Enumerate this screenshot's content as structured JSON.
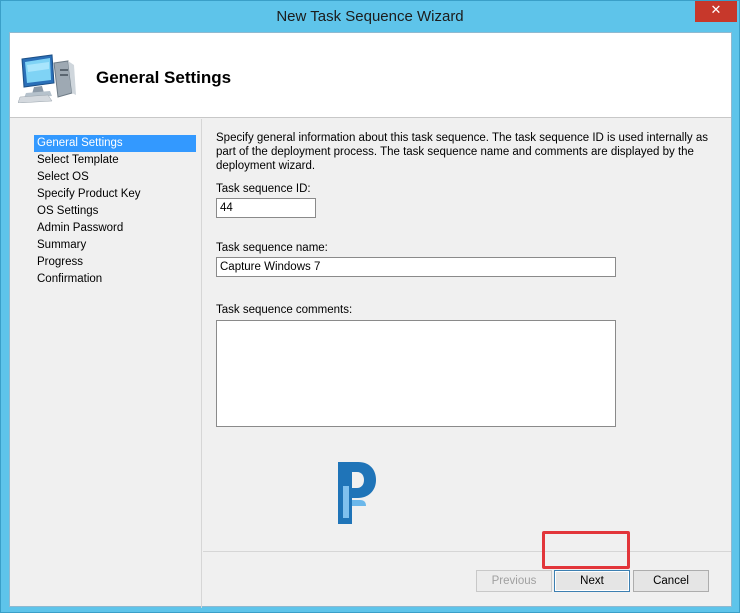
{
  "window": {
    "title": "New Task Sequence Wizard",
    "close_symbol": "✕"
  },
  "header": {
    "title": "General Settings",
    "icon": "computer-icon"
  },
  "nav": {
    "items": [
      {
        "label": "General Settings",
        "active": true
      },
      {
        "label": "Select Template",
        "active": false
      },
      {
        "label": "Select OS",
        "active": false
      },
      {
        "label": "Specify Product Key",
        "active": false
      },
      {
        "label": "OS Settings",
        "active": false
      },
      {
        "label": "Admin Password",
        "active": false
      },
      {
        "label": "Summary",
        "active": false
      },
      {
        "label": "Progress",
        "active": false
      },
      {
        "label": "Confirmation",
        "active": false
      }
    ]
  },
  "main": {
    "description": "Specify general information about this task sequence.  The task sequence ID is used internally as part of the deployment process.  The task sequence name and comments are displayed by the deployment wizard.",
    "id_label": "Task sequence ID:",
    "id_value": "44",
    "name_label": "Task sequence name:",
    "name_value": "Capture Windows 7",
    "comments_label": "Task sequence comments:",
    "comments_value": ""
  },
  "buttons": {
    "previous": "Previous",
    "next": "Next",
    "cancel": "Cancel"
  },
  "colors": {
    "titlebar": "#5ec4ea",
    "close": "#c7382b",
    "nav_active": "#3399ff",
    "highlight": "#e2353a",
    "logo_blue": "#1f74b8"
  }
}
